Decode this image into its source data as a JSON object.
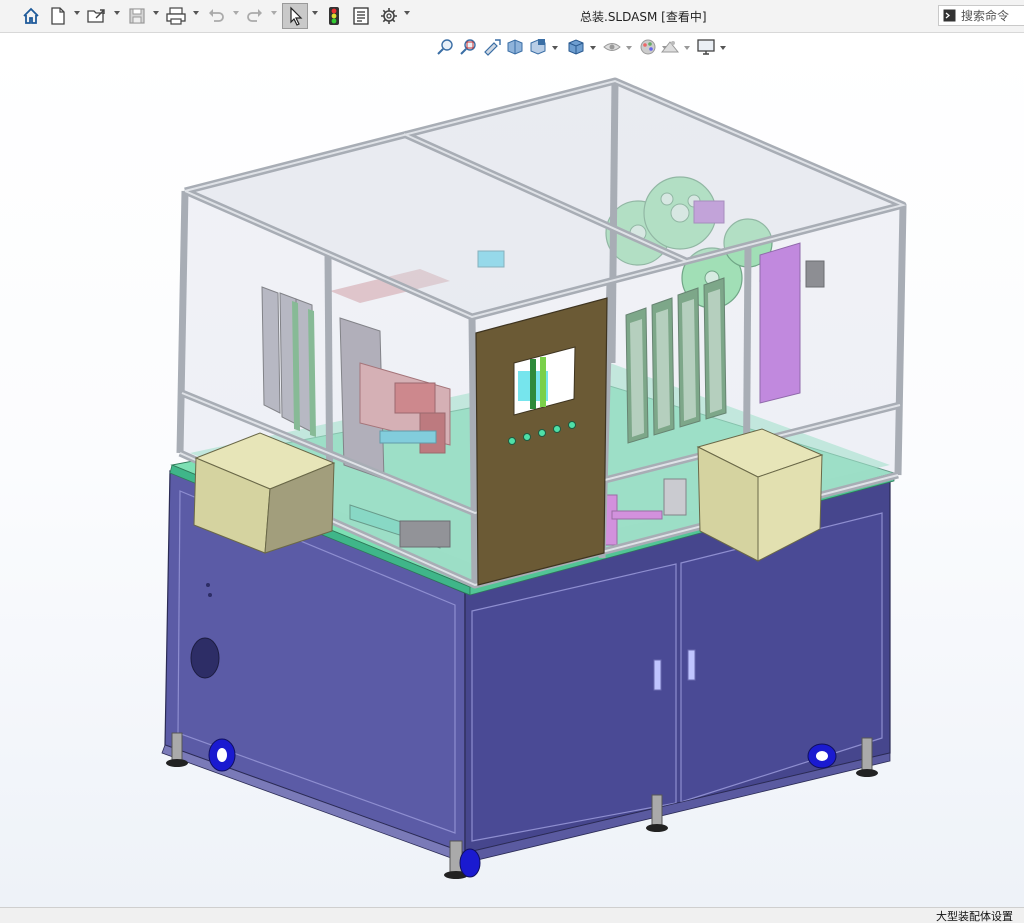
{
  "window": {
    "document_title": "总装.SLDASM [查看中]"
  },
  "toolbar": {
    "items": [
      {
        "icon": "home-icon"
      },
      {
        "icon": "new-document-icon"
      },
      {
        "icon": "open-file-icon"
      },
      {
        "icon": "save-icon"
      },
      {
        "icon": "print-icon"
      },
      {
        "icon": "undo-icon"
      },
      {
        "icon": "redo-icon"
      },
      {
        "icon": "select-arrow-icon",
        "active": true
      },
      {
        "icon": "rebuild-traffic-light-icon"
      },
      {
        "icon": "file-properties-icon"
      },
      {
        "icon": "options-gear-icon"
      }
    ]
  },
  "search": {
    "placeholder": "搜索命令"
  },
  "heads_up_toolbar": {
    "items": [
      "zoom-to-fit-icon",
      "zoom-to-area-icon",
      "previous-view-icon",
      "section-view-icon",
      "view-orientation-icon",
      "display-style-icon",
      "hide-show-items-icon",
      "edit-appearance-icon",
      "apply-scene-icon",
      "view-settings-icon"
    ]
  },
  "status_bar": {
    "text": "大型装配体设置"
  },
  "colors": {
    "cabinet": "#4a4a92",
    "frame": "#b9bdc4",
    "panel_door": "#6b5a34",
    "box": "#d9d7a2",
    "base_plate": "#5fd4a5",
    "wheel": "#2a2ad8",
    "accent_purple": "#a04fd0"
  }
}
